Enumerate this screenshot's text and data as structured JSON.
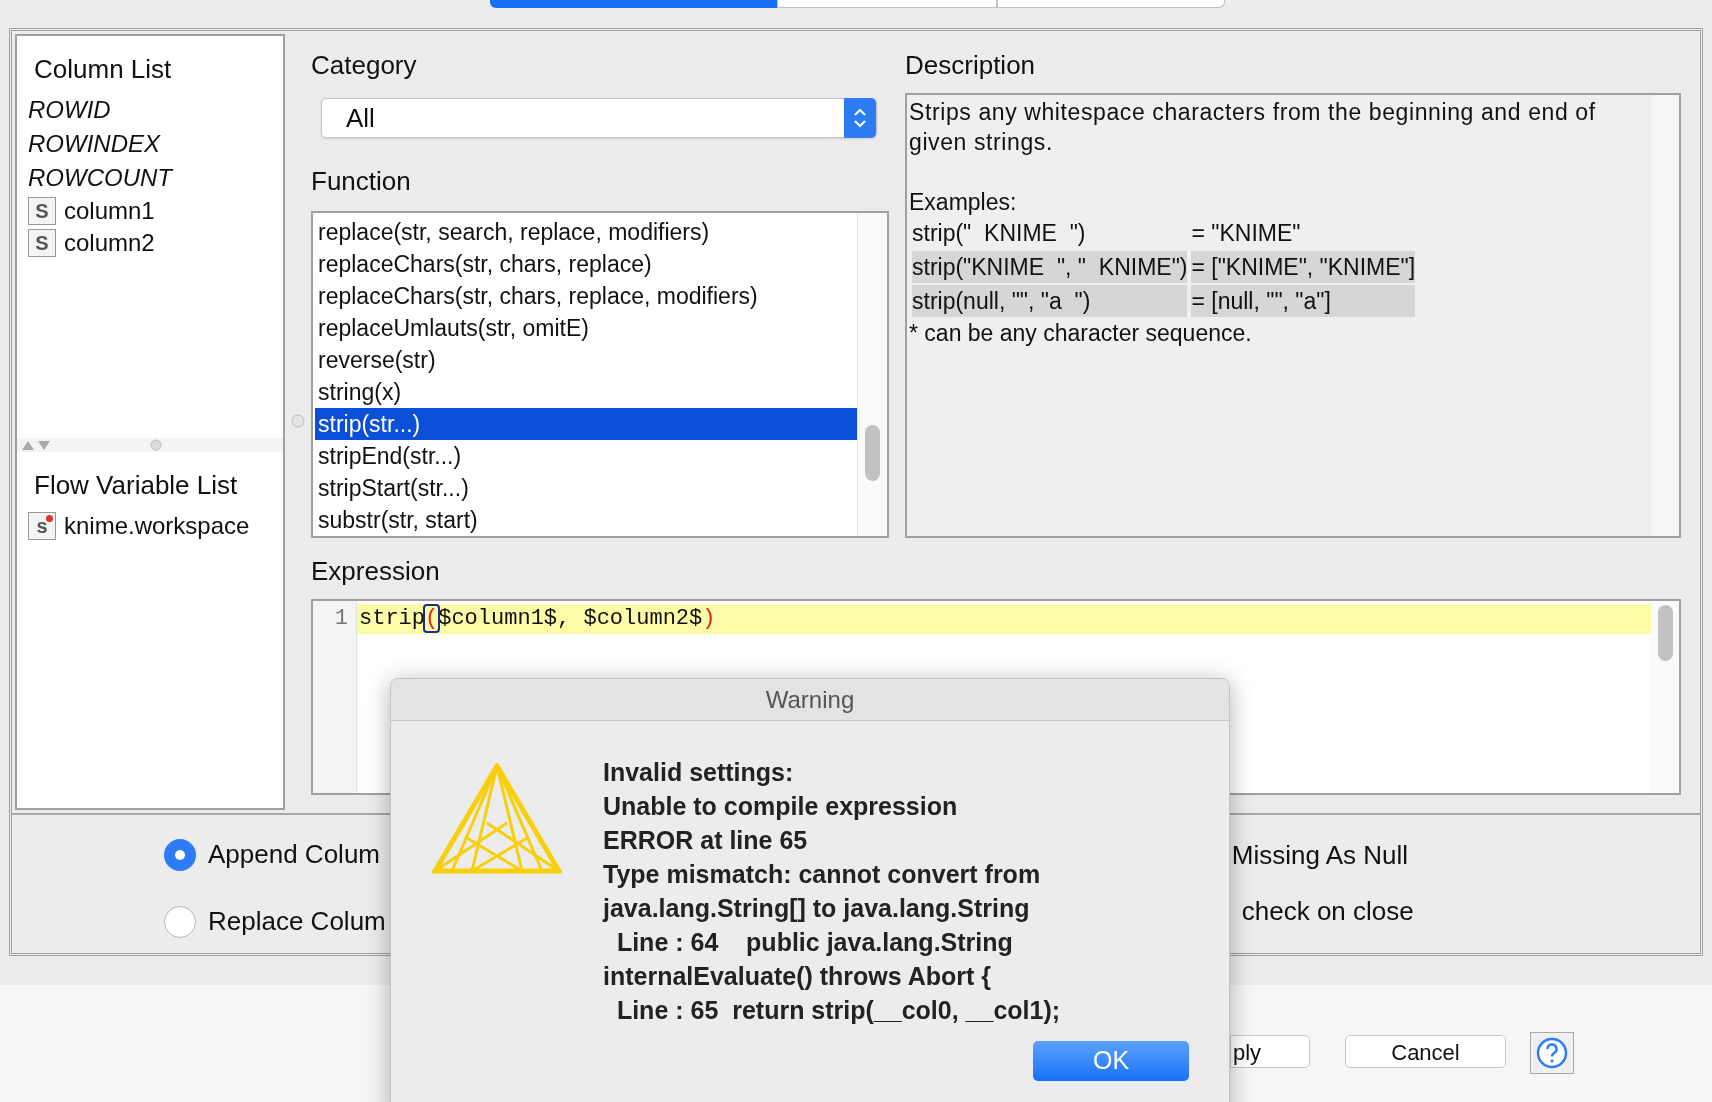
{
  "tabs": [
    {
      "selected": true
    },
    {
      "selected": false
    },
    {
      "selected": false
    }
  ],
  "column_list": {
    "title": "Column List",
    "items": [
      {
        "kind": "special",
        "label": "ROWID"
      },
      {
        "kind": "special",
        "label": "ROWINDEX"
      },
      {
        "kind": "special",
        "label": "ROWCOUNT"
      },
      {
        "kind": "column",
        "type_badge": "S",
        "label": "column1"
      },
      {
        "kind": "column",
        "type_badge": "S",
        "label": "column2"
      }
    ]
  },
  "flow_variable_list": {
    "title": "Flow Variable List",
    "items": [
      {
        "type_badge": "s",
        "label": "knime.workspace"
      }
    ]
  },
  "category": {
    "label": "Category",
    "value": "All"
  },
  "function": {
    "label": "Function",
    "items": [
      {
        "label": "replace(str, search, replace, modifiers)",
        "selected": false
      },
      {
        "label": "replaceChars(str, chars, replace)",
        "selected": false
      },
      {
        "label": "replaceChars(str, chars, replace, modifiers)",
        "selected": false
      },
      {
        "label": "replaceUmlauts(str, omitE)",
        "selected": false
      },
      {
        "label": "reverse(str)",
        "selected": false
      },
      {
        "label": "string(x)",
        "selected": false
      },
      {
        "label": "strip(str...)",
        "selected": true
      },
      {
        "label": "stripEnd(str...)",
        "selected": false
      },
      {
        "label": "stripStart(str...)",
        "selected": false
      },
      {
        "label": "substr(str, start)",
        "selected": false
      }
    ]
  },
  "description": {
    "label": "Description",
    "text": "Strips any whitespace characters from the beginning and end of given strings.",
    "examples_heading": "Examples:",
    "examples": [
      {
        "call": "strip(\"  KNIME  \")",
        "result": "= \"KNIME\"",
        "highlighted": false
      },
      {
        "call": "strip(\"KNIME  \", \"  KNIME\")",
        "result": "= [\"KNIME\", \"KNIME\"]",
        "highlighted": true
      },
      {
        "call": "strip(null, \"\", \"a  \")",
        "result": "= [null, \"\", \"a\"]",
        "highlighted": true
      }
    ],
    "note": "* can be any character sequence."
  },
  "expression": {
    "label": "Expression",
    "lines": [
      {
        "number": "1",
        "segments": [
          {
            "kind": "plain",
            "text": "strip"
          },
          {
            "kind": "bracket-match",
            "text": "("
          },
          {
            "kind": "plain",
            "text": "$column1$, $column2$"
          },
          {
            "kind": "bracket-unmatched",
            "text": ")"
          }
        ]
      }
    ]
  },
  "output_options": [
    {
      "label": "Append Colum",
      "selected": true
    },
    {
      "label": "Replace Colum",
      "selected": false
    }
  ],
  "checkbox_labels": [
    "Missing As Null",
    "check on close"
  ],
  "buttons": [
    {
      "kind": "partial",
      "label": "ply"
    },
    {
      "kind": "normal",
      "label": "Cancel"
    },
    {
      "kind": "help"
    }
  ],
  "dialog": {
    "title": "Warning",
    "message_lines": [
      "Invalid settings:",
      "Unable to compile expression",
      "ERROR at line 65",
      "Type mismatch: cannot convert from",
      "java.lang.String[] to java.lang.String",
      "  Line : 64    public java.lang.String",
      "internalEvaluate() throws Abort {",
      "  Line : 65  return strip(__col0, __col1);"
    ],
    "ok": "OK"
  }
}
